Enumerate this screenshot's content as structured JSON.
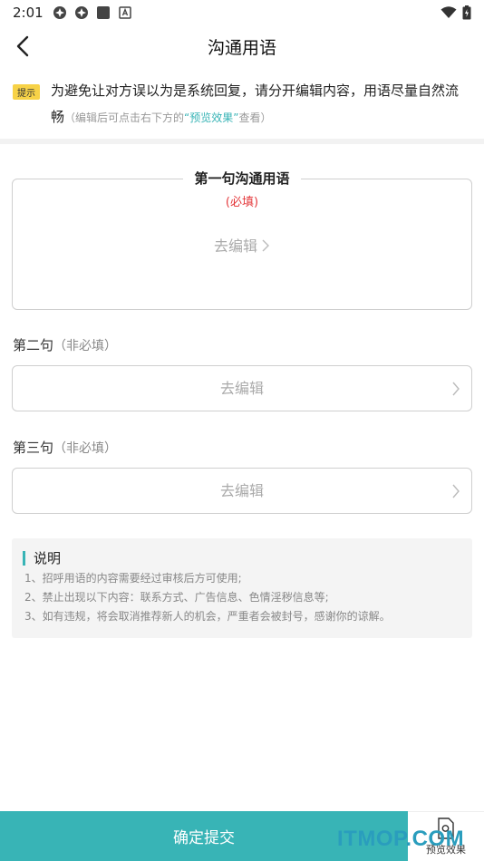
{
  "status_bar": {
    "time": "2:01",
    "icons": [
      "pinwheel-icon",
      "pinwheel-icon",
      "square-icon",
      "a-icon"
    ],
    "right_icons": [
      "wifi-icon",
      "battery-icon"
    ]
  },
  "header": {
    "title": "沟通用语",
    "back_icon": "chevron-left-icon"
  },
  "tip": {
    "badge": "提示",
    "text": "为避免让对方误以为是系统回复，请分开编辑内容，用语尽量自然流畅",
    "sub_prefix": "（编辑后可点击右下方的",
    "sub_link": "“预览效果”",
    "sub_suffix": "查看）"
  },
  "first": {
    "label": "第一句沟通用语",
    "required": "(必填)",
    "edit": "去编辑"
  },
  "second": {
    "label": "第二句",
    "optional": "（非必填）",
    "placeholder": "去编辑"
  },
  "third": {
    "label": "第三句",
    "optional": "（非必填）",
    "placeholder": "去编辑"
  },
  "notes": {
    "title": "说明",
    "items": [
      "1、招呼用语的内容需要经过审核后方可使用;",
      "2、禁止出现以下内容：联系方式、广告信息、色情淫秽信息等;",
      "3、如有违规，将会取消推荐新人的机会，严重者会被封号，感谢你的谅解。"
    ]
  },
  "bottom": {
    "submit": "确定提交",
    "preview": "预览效果"
  },
  "watermark": "ITMOP.COM",
  "colors": {
    "accent": "#38b4b6",
    "required": "#e4393c",
    "badge": "#f7d247"
  }
}
